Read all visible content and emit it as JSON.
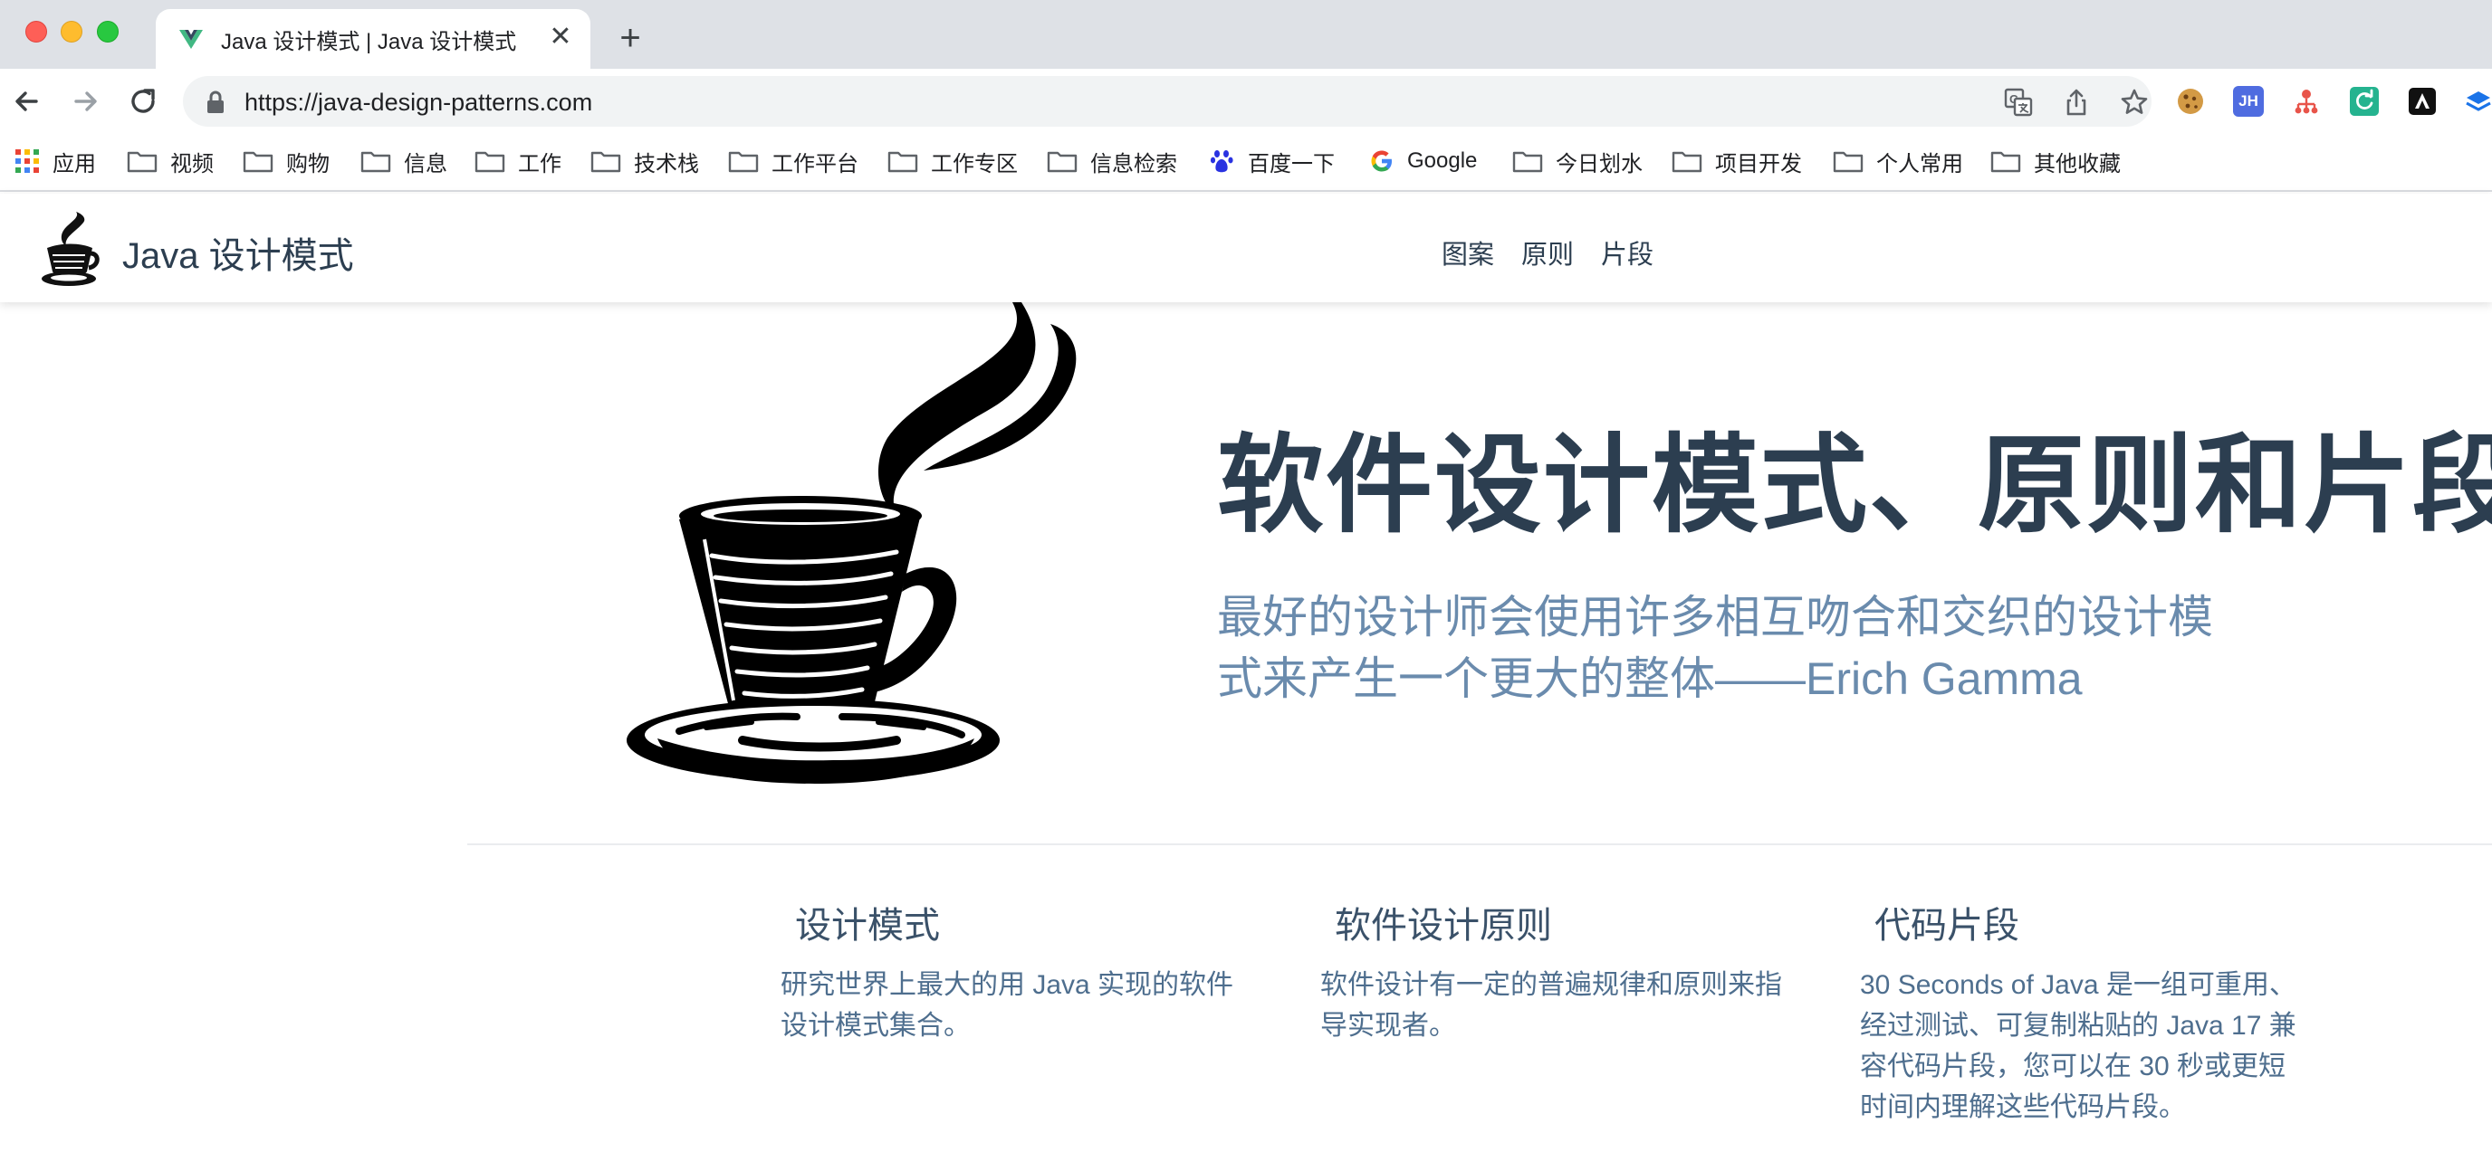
{
  "browser": {
    "tab_title": "Java 设计模式 | Java 设计模式",
    "tab_close": "✕",
    "new_tab": "+",
    "url": "https://java-design-patterns.com",
    "extensions": [
      {
        "name": "cookie-extension-icon",
        "label": "",
        "color": "#c8883a"
      },
      {
        "name": "jh-extension-icon",
        "label": "JH",
        "color": "#4f6ce0"
      },
      {
        "name": "network-extension-icon",
        "label": "",
        "color": "#e8544a"
      },
      {
        "name": "refresh-extension-icon",
        "label": "",
        "color": "#25b38f"
      },
      {
        "name": "notion-extension-icon",
        "label": "",
        "color": "#111111"
      },
      {
        "name": "layers-extension-icon",
        "label": "",
        "color": "#1a73e8"
      }
    ]
  },
  "bookmarks": [
    {
      "label": "应用",
      "icon": "apps-grid-icon"
    },
    {
      "label": "视频",
      "icon": "folder-icon"
    },
    {
      "label": "购物",
      "icon": "folder-icon"
    },
    {
      "label": "信息",
      "icon": "folder-icon"
    },
    {
      "label": "工作",
      "icon": "folder-icon"
    },
    {
      "label": "技术栈",
      "icon": "folder-icon"
    },
    {
      "label": "工作平台",
      "icon": "folder-icon"
    },
    {
      "label": "工作专区",
      "icon": "folder-icon"
    },
    {
      "label": "信息检索",
      "icon": "folder-icon"
    },
    {
      "label": "百度一下",
      "icon": "baidu-paw-icon"
    },
    {
      "label": "Google",
      "icon": "google-g-icon"
    },
    {
      "label": "今日划水",
      "icon": "folder-icon"
    },
    {
      "label": "项目开发",
      "icon": "folder-icon"
    },
    {
      "label": "个人常用",
      "icon": "folder-icon"
    },
    {
      "label": "其他收藏",
      "icon": "folder-icon"
    }
  ],
  "site": {
    "name": "Java 设计模式",
    "nav": [
      "图案",
      "原则",
      "片段"
    ],
    "hero": {
      "title": "软件设计模式、原则和片段",
      "tagline": "最好的设计师会使用许多相互吻合和交织的设计模式来产生一个更大的整体——Erich Gamma"
    },
    "features": [
      {
        "title": "设计模式",
        "text": "研究世界上最大的用 Java 实现的软件设计模式集合。"
      },
      {
        "title": "软件设计原则",
        "text": "软件设计有一定的普遍规律和原则来指导实现者。"
      },
      {
        "title": "代码片段",
        "text": "30 Seconds of Java 是一组可重用、经过测试、可复制粘贴的 Java 17 兼容代码片段，您可以在 30 秒或更短时间内理解这些代码片段。"
      }
    ]
  },
  "colors": {
    "heading": "#2c3e50",
    "tagline": "#6a8bad",
    "feature_text": "#4e6e8e"
  }
}
